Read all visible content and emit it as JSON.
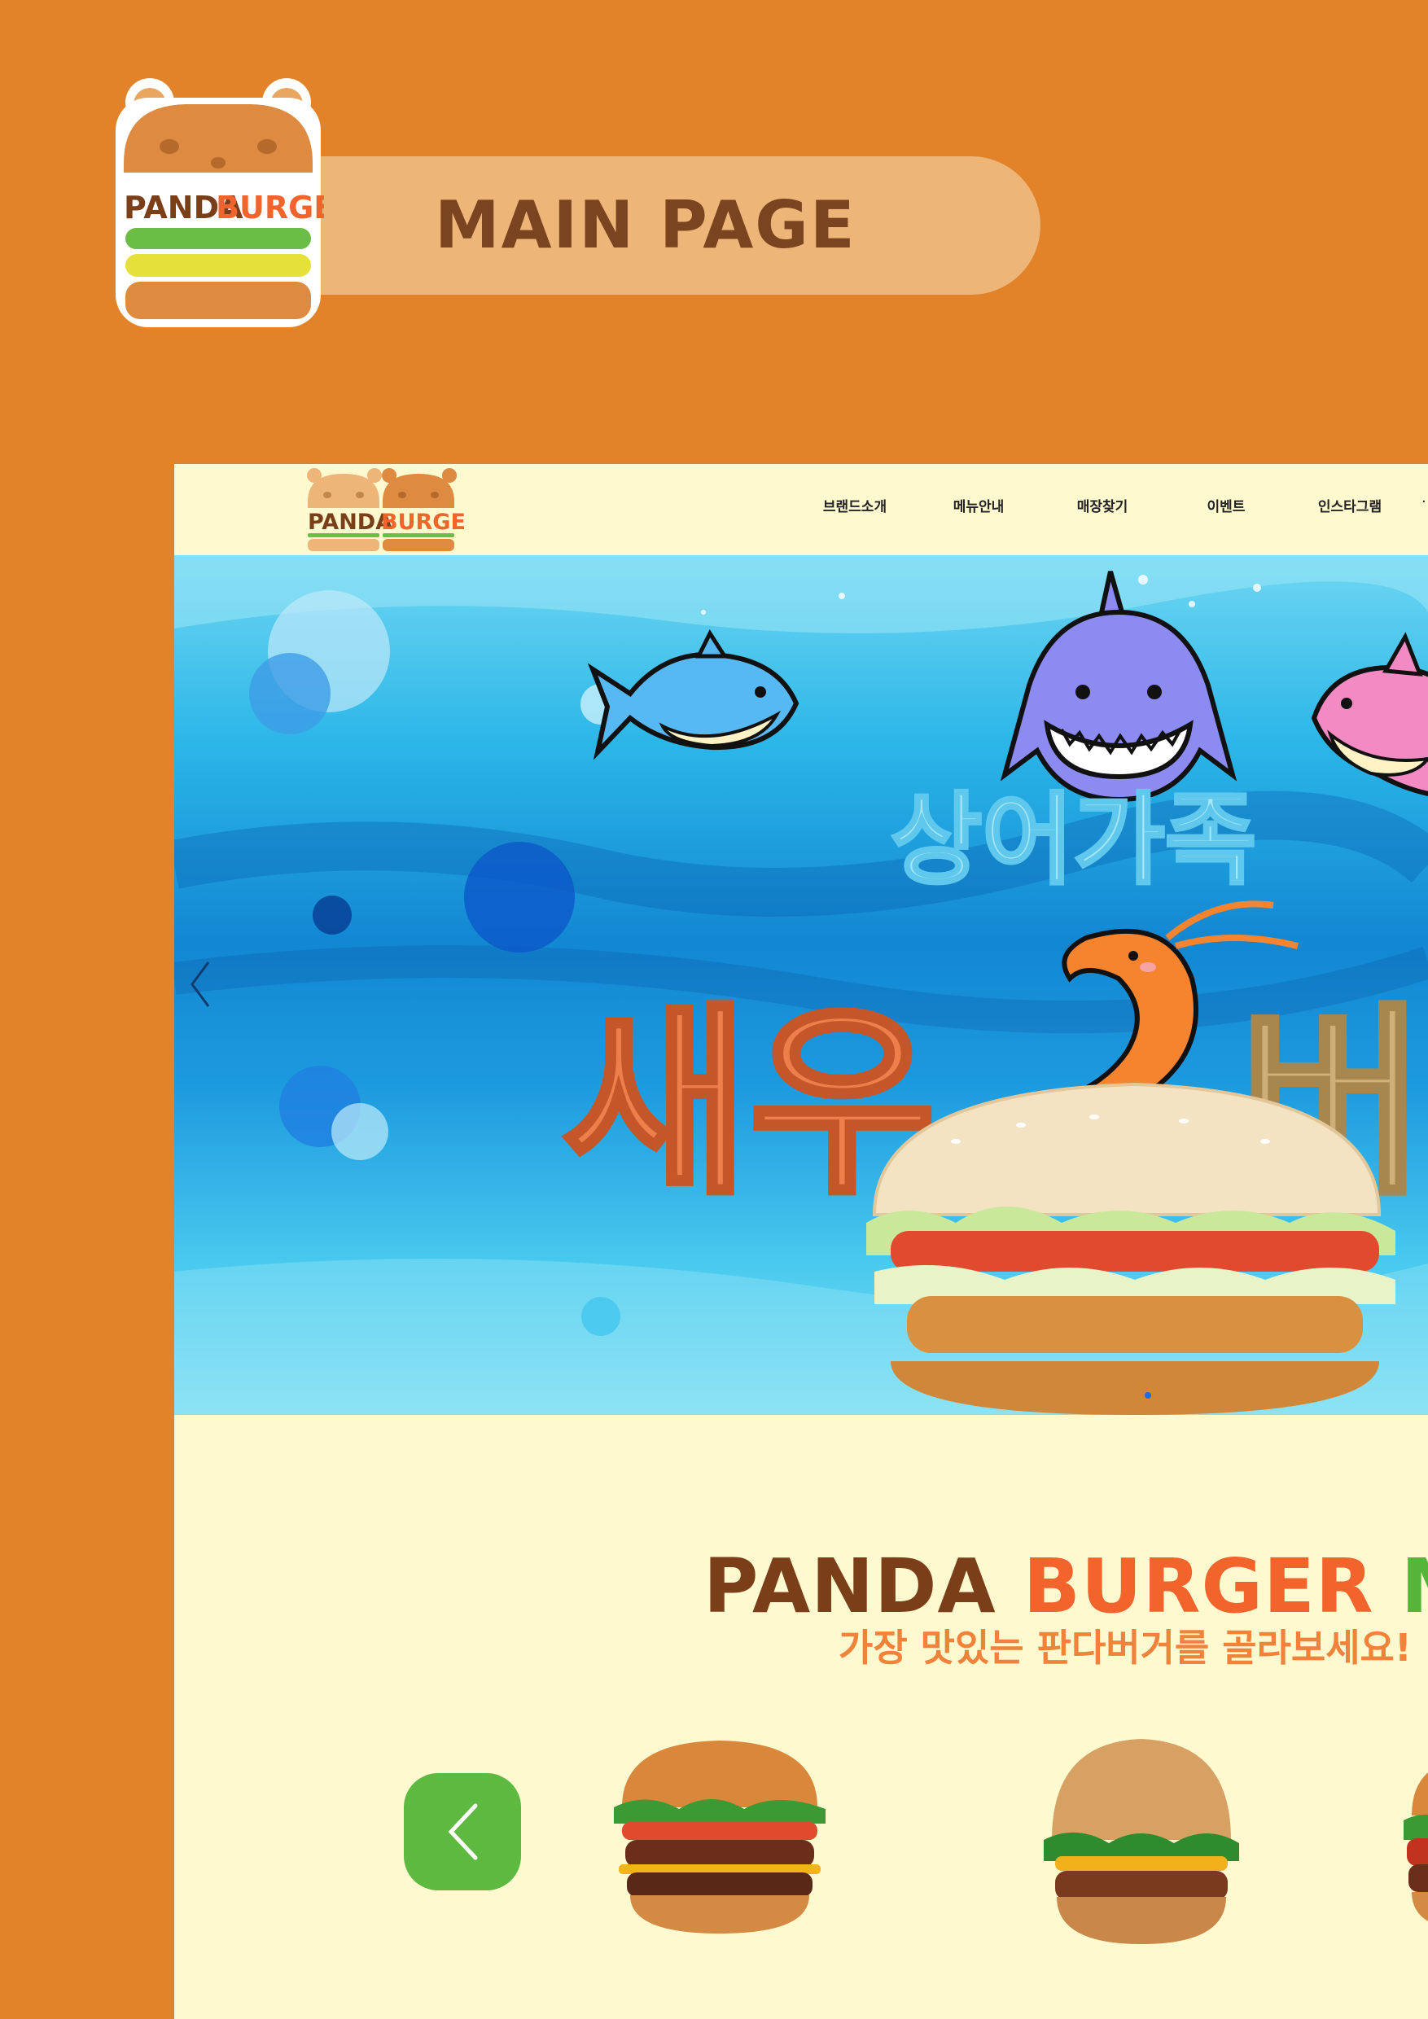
{
  "slide": {
    "title": "MAIN PAGE",
    "logo_text_1": "PANDA",
    "logo_text_2": "BURGER"
  },
  "site": {
    "logo_text_1": "PANDA",
    "logo_text_2": "BURGER",
    "nav": [
      "브랜드소개",
      "메뉴안내",
      "매장찾기",
      "이벤트",
      "인스타그램"
    ],
    "hero": {
      "headline_top": "상어가족",
      "headline_main": "새우",
      "headline_right": "버",
      "prev_icon": "chevron-left-icon"
    },
    "menu": {
      "title_1": "PANDA",
      "title_2": "BURGER",
      "title_3": "ME",
      "subtitle": "가장 맛있는 판다버거를 골라보세요!",
      "prev_icon": "chevron-left-icon"
    }
  },
  "colors": {
    "background": "#E28229",
    "pill": "#EDB578",
    "pill_text": "#7A4420",
    "site_bg": "#FFF9CF",
    "brand_brown": "#7A3E18",
    "brand_orange": "#F2642C",
    "brand_green": "#55B53A",
    "button_green": "#5DB93F"
  }
}
